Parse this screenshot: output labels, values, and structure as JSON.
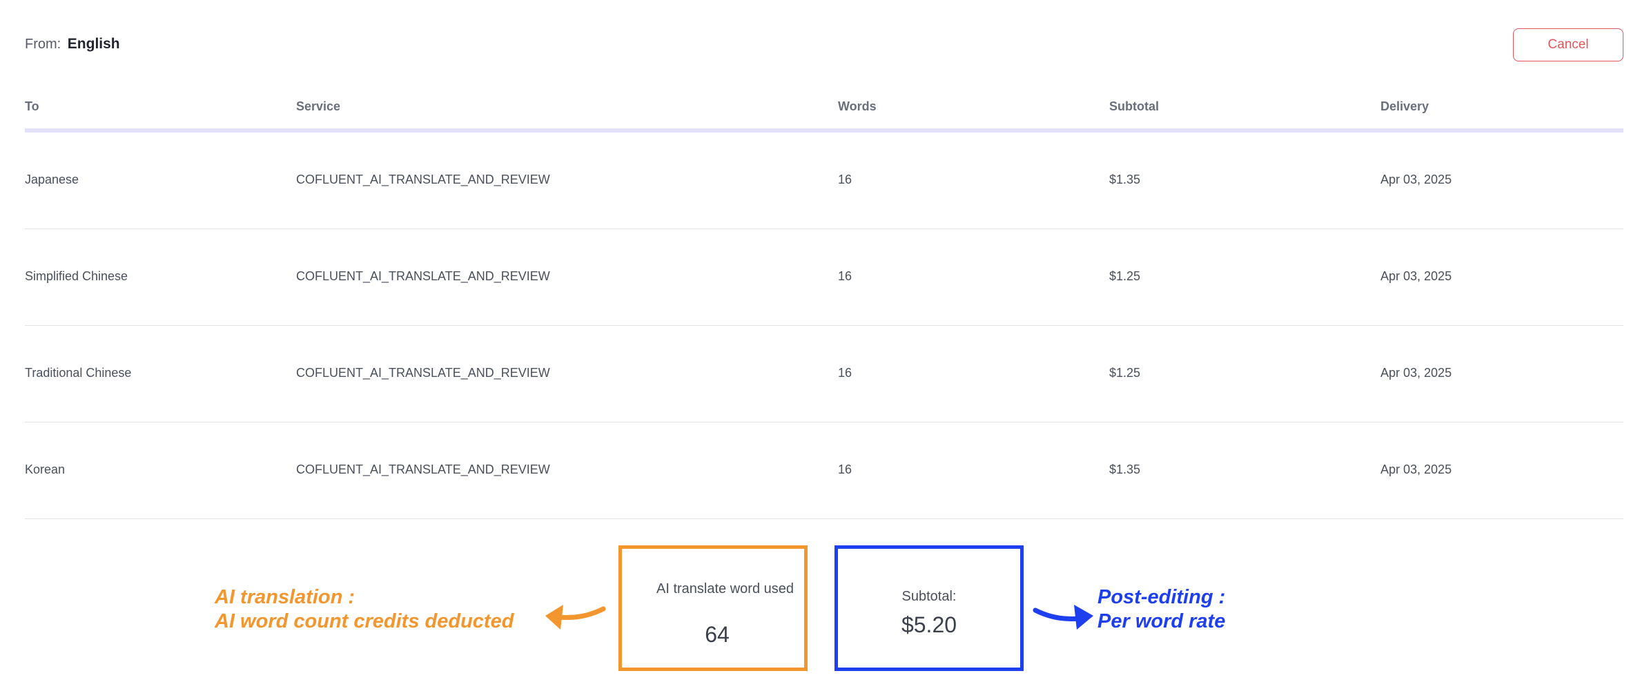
{
  "header": {
    "from_label": "From:",
    "from_language": "English",
    "cancel_label": "Cancel"
  },
  "table": {
    "columns": [
      "To",
      "Service",
      "Words",
      "Subtotal",
      "Delivery"
    ],
    "rows": [
      {
        "to": "Japanese",
        "service": "COFLUENT_AI_TRANSLATE_AND_REVIEW",
        "words": "16",
        "subtotal": "$1.35",
        "delivery": "Apr 03, 2025"
      },
      {
        "to": "Simplified Chinese",
        "service": "COFLUENT_AI_TRANSLATE_AND_REVIEW",
        "words": "16",
        "subtotal": "$1.25",
        "delivery": "Apr 03, 2025"
      },
      {
        "to": "Traditional Chinese",
        "service": "COFLUENT_AI_TRANSLATE_AND_REVIEW",
        "words": "16",
        "subtotal": "$1.25",
        "delivery": "Apr 03, 2025"
      },
      {
        "to": "Korean",
        "service": "COFLUENT_AI_TRANSLATE_AND_REVIEW",
        "words": "16",
        "subtotal": "$1.35",
        "delivery": "Apr 03, 2025"
      }
    ]
  },
  "summary": {
    "ai_words_label": "AI translate word used",
    "ai_words_value": "64",
    "subtotal_label": "Subtotal:",
    "subtotal_value": "$5.20"
  },
  "annotations": {
    "ai_line1": "AI translation :",
    "ai_line2": "AI word count credits deducted",
    "pe_line1": "Post-editing :",
    "pe_line2": "Per word rate"
  },
  "colors": {
    "ai_highlight": "#f3962d",
    "postedit_highlight": "#1d3ff0",
    "cancel": "#e0565b",
    "header_rule": "#e2e0fb"
  },
  "icons": [
    "left-arrow-icon",
    "right-arrow-icon"
  ]
}
